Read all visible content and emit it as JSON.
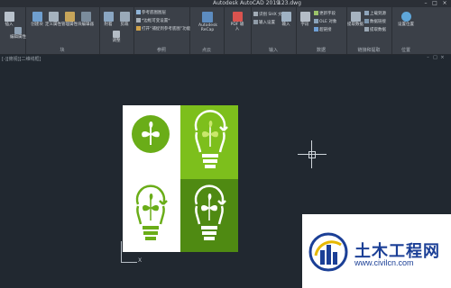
{
  "window": {
    "app_title": "Autodesk AutoCAD 2019",
    "file_name": "123.dwg"
  },
  "ribbon": {
    "groups": [
      {
        "label": ""
      },
      {
        "label": "块"
      },
      {
        "label": ""
      },
      {
        "label": "参照"
      },
      {
        "label": "点云"
      },
      {
        "label": ""
      },
      {
        "label": "输入"
      },
      {
        "label": "数据"
      },
      {
        "label": "链接和提取"
      },
      {
        "label": "位置"
      }
    ],
    "buttons": {
      "insert": "插入",
      "edit_attr": "编辑属性",
      "create": "创建块",
      "define_attr": "定义属性",
      "manage_attr": "管理属性",
      "block_editor": "块编辑器",
      "attach": "附着",
      "clip": "剪裁",
      "adjust": "调整",
      "recap": "Autodesk ReCap",
      "pdf_import": "PDF 输入",
      "import": "输入",
      "field": "字段",
      "extract": "提取数据",
      "set_location": "设置位置"
    },
    "small_buttons": {
      "frame": "参考底图图层",
      "snap": "*边框可变设置*",
      "dwf": "打开“捕捉到参考底图”功能",
      "pdf_layer": "识别 SHX 文字",
      "ole": "OLE 对象",
      "hyperlink": "超链接",
      "update_fields": "更新字段",
      "link_data": "上载到源",
      "link": "数据链接",
      "extract_data": "提取数据",
      "import_settings": "输入设置"
    }
  },
  "viewport": {
    "label": "[-][俯视][二维线框]"
  },
  "ucs": {
    "x_label": "X"
  },
  "watermark": {
    "text": "土木工程网",
    "url": "www.civilcn.com"
  }
}
